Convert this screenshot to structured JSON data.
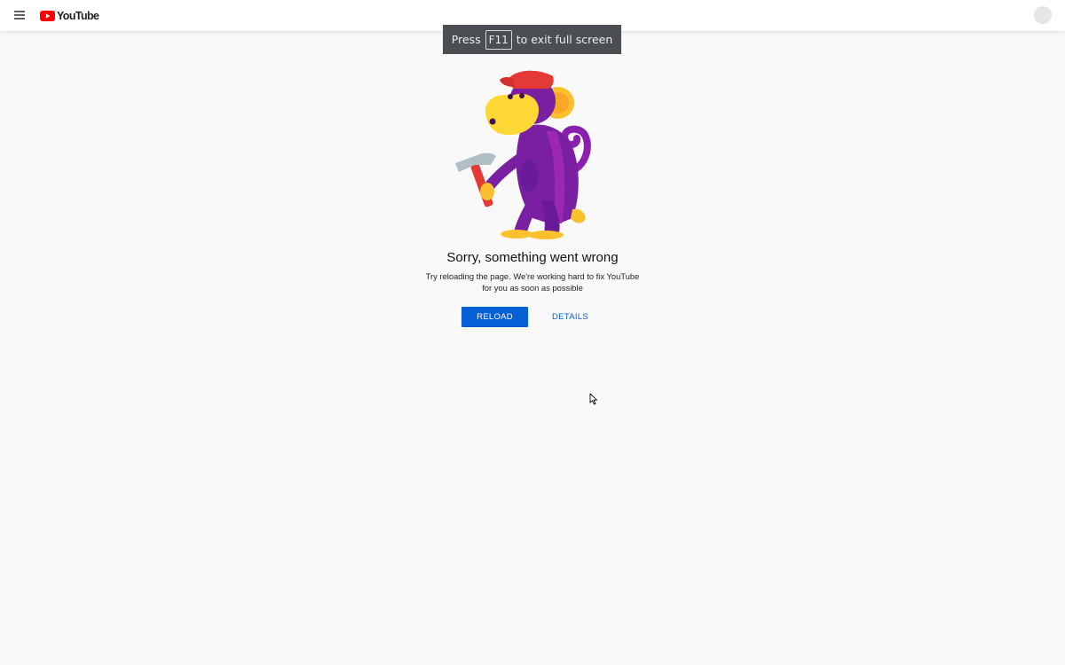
{
  "header": {
    "logo_text": "YouTube",
    "logo_icon": "youtube-play-icon",
    "menu_icon": "hamburger-menu-icon",
    "avatar_icon": "user-avatar"
  },
  "fullscreen_banner": {
    "before": "Press",
    "key": "F11",
    "after": "to exit full screen"
  },
  "error": {
    "illustration": "monkey-with-hammer-illustration",
    "title": "Sorry, something went wrong",
    "message": "Try reloading the page. We're working hard to fix YouTube for you as soon as possible"
  },
  "actions": {
    "reload_label": "RELOAD",
    "details_label": "DETAILS"
  },
  "colors": {
    "brand_red": "#ff0000",
    "primary_blue": "#065fd4",
    "background": "#f9f9f9",
    "banner_bg": "#4b4e52"
  }
}
